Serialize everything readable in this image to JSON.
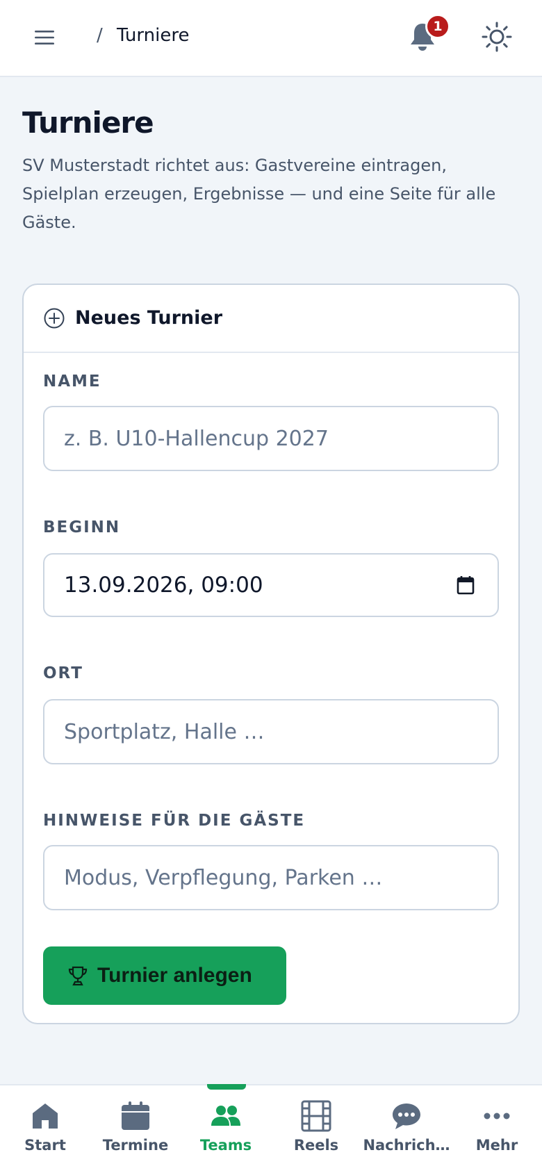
{
  "colors": {
    "accent": "#16a05a",
    "badge": "#b91c1c",
    "text_primary": "#0f172a",
    "text_muted": "#475569",
    "icon_gray": "#5b6b80"
  },
  "header": {
    "breadcrumb_separator": "/",
    "breadcrumb_current": "Turniere",
    "notification_count": "1",
    "icons": [
      "menu-icon",
      "bell-icon",
      "sun-icon"
    ]
  },
  "page": {
    "title": "Turniere",
    "description": "SV Musterstadt richtet aus: Gastvereine eintragen, Spielplan erzeugen, Ergebnisse — und eine Seite für alle Gäste."
  },
  "form": {
    "header_title": "Neues Turnier",
    "name": {
      "label": "NAME",
      "value": "",
      "placeholder": "z. B. U10-Hallencup 2027"
    },
    "start": {
      "label": "BEGINN",
      "value": "13.09.2026, 09:00"
    },
    "location": {
      "label": "ORT",
      "value": "",
      "placeholder": "Sportplatz, Halle …"
    },
    "notes": {
      "label": "HINWEISE FÜR DIE GÄSTE",
      "value": "",
      "placeholder": "Modus, Verpflegung, Parken …"
    },
    "submit_label": "Turnier anlegen"
  },
  "bottom_nav": {
    "active": "Teams",
    "items": [
      {
        "label": "Start",
        "icon": "home-icon"
      },
      {
        "label": "Termine",
        "icon": "calendar-icon"
      },
      {
        "label": "Teams",
        "icon": "users-icon"
      },
      {
        "label": "Reels",
        "icon": "film-icon"
      },
      {
        "label": "Nachrich…",
        "icon": "chat-icon"
      },
      {
        "label": "Mehr",
        "icon": "more-icon"
      }
    ]
  }
}
